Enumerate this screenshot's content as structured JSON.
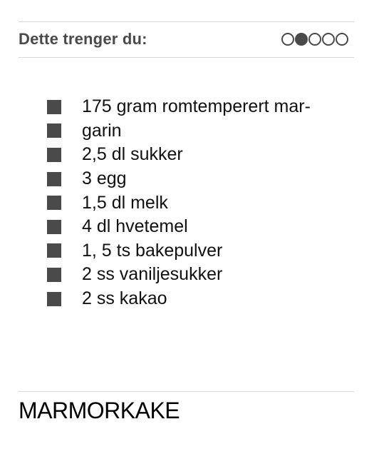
{
  "header": {
    "title": "Dette trenger du:",
    "difficulty": {
      "level": 2,
      "max": 5
    }
  },
  "ingredients": [
    "175 gram romtemperert mar-",
    "garin",
    "2,5 dl sukker",
    "3 egg",
    "1,5 dl melk",
    "4 dl hvetemel",
    "1, 5 ts bakepulver",
    "2 ss vaniljesukker",
    "2 ss kakao"
  ],
  "recipe": {
    "title": "MARMORKAKE"
  },
  "colors": {
    "accent": "#4a4a4a",
    "text": "#111111",
    "rule": "#d9d9d9"
  }
}
